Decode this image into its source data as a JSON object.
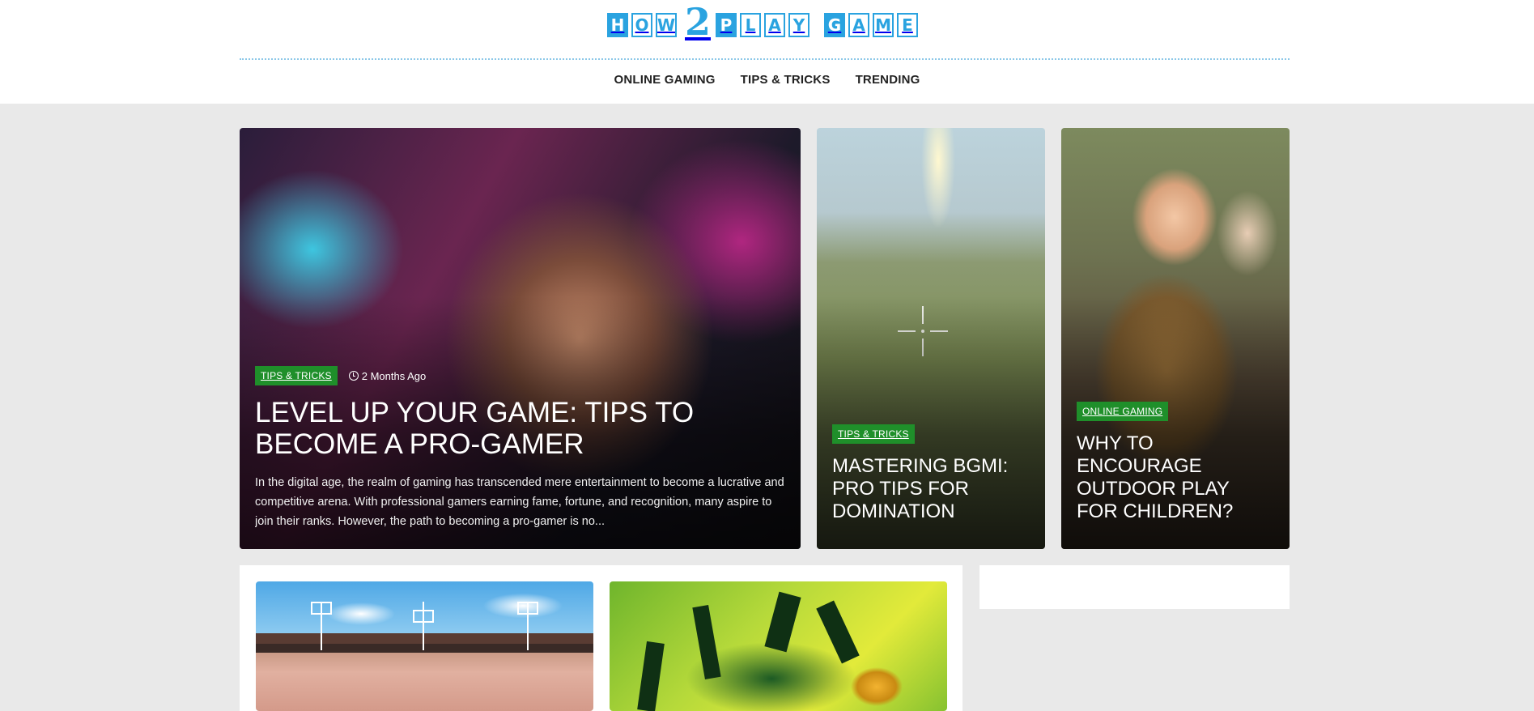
{
  "header": {
    "logo": {
      "part1": [
        "H",
        "O",
        "W"
      ],
      "two": "2",
      "part2": [
        "P",
        "L",
        "A",
        "Y"
      ],
      "part3": [
        "G",
        "A",
        "M",
        "E"
      ]
    },
    "nav": [
      {
        "label": "ONLINE GAMING"
      },
      {
        "label": "TIPS & TRICKS"
      },
      {
        "label": "TRENDING"
      }
    ]
  },
  "featured": {
    "hero": {
      "category": "TIPS & TRICKS",
      "date": "2 Months Ago",
      "title": "LEVEL UP YOUR GAME: TIPS TO BECOME A PRO-GAMER",
      "excerpt": "In the digital age, the realm of gaming has transcended mere entertainment to become a lucrative and competitive arena. With professional gamers earning fame, fortune, and recognition, many aspire to join their ranks. However, the path to becoming a pro-gamer is no..."
    },
    "side1": {
      "category": "TIPS & TRICKS",
      "title": "MASTERING BGMI: PRO TIPS FOR DOMINATION"
    },
    "side2": {
      "category": "ONLINE GAMING",
      "title": "WHY TO ENCOURAGE OUTDOOR PLAY FOR CHILDREN?"
    }
  },
  "colors": {
    "brand": "#2aa3e0",
    "badge": "#1f8f2a"
  }
}
